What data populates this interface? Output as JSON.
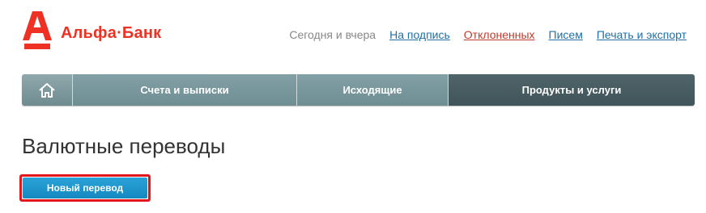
{
  "logo": {
    "text": "Альфа·Банк",
    "color": "#ef3124",
    "icon": "alfa-logo-icon"
  },
  "topnav": {
    "label": "Сегодня и вчера",
    "links": [
      "На подпись",
      "Отклоненных",
      "Писем",
      "Печать и экспорт"
    ]
  },
  "mainnav": {
    "home_icon": "home-icon",
    "tabs": [
      {
        "label": "Счета и выписки",
        "active": false
      },
      {
        "label": "Исходящие",
        "active": false
      },
      {
        "label": "Продукты и услуги",
        "active": true
      }
    ]
  },
  "page": {
    "title": "Валютные переводы",
    "new_transfer_button": "Новый перевод"
  },
  "colors": {
    "brand_red": "#ef3124",
    "nav_bg": "#7a979c",
    "nav_active": "#475c61",
    "button": "#1b95cc",
    "highlight": "#e3161b"
  }
}
